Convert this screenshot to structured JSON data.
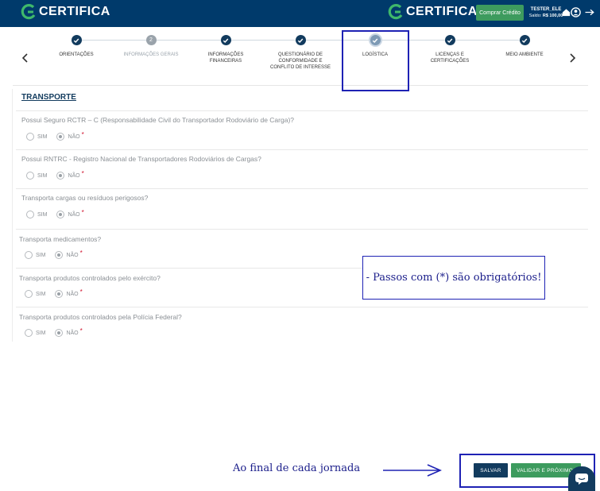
{
  "header": {
    "brand": "CERTIFICA",
    "buy_credit_label": "Comprar Crédito",
    "user_name": "TESTER_ELE",
    "balance_label": "Saldo:",
    "balance_value": "R$ 100,00"
  },
  "stepper": {
    "steps": [
      {
        "label": "ORIENTAÇÕES",
        "state": "done"
      },
      {
        "label": "INFORMAÇÕES GERAIS",
        "state": "number",
        "number": "2"
      },
      {
        "label": "INFORMAÇÕES FINANCEIRAS",
        "state": "done"
      },
      {
        "label": "QUESTIONÁRIO DE CONFORMIDADE E CONFLITO DE INTERESSE",
        "state": "done"
      },
      {
        "label": "LOGÍSTICA",
        "state": "active"
      },
      {
        "label": "LICENÇAS E CERTIFICAÇÕES",
        "state": "done"
      },
      {
        "label": "MEIO AMBIENTE",
        "state": "done"
      }
    ]
  },
  "section": {
    "title": "TRANSPORTE",
    "yes_label": "SIM",
    "no_label": "NÃO",
    "required_mark": "*",
    "questions": [
      {
        "text": "Possui Seguro RCTR – C (Responsabilidade Civil do Transportador Rodoviário de Carga)?",
        "selected": "no"
      },
      {
        "text": "Possui RNTRC - Registro Nacional de Transportadores Rodoviários de Cargas?",
        "selected": "no"
      },
      {
        "text": "Transporta cargas ou resíduos perigosos?",
        "selected": "no"
      },
      {
        "text": "Transporta medicamentos?",
        "selected": "no"
      },
      {
        "text": "Transporta produtos controlados pelo exército?",
        "selected": "no"
      },
      {
        "text": "Transporta produtos controlados pela Polícia Federal?",
        "selected": "no"
      }
    ]
  },
  "annotations": {
    "required_note": "- Passos com (*) são obrigatórios!",
    "end_note": "Ao final de cada jornada"
  },
  "actions": {
    "save_label": "SALVAR",
    "validate_label": "VALIDAR E PRÓXIMO"
  },
  "colors": {
    "header": "#003a6b",
    "primary": "#123b5e",
    "success": "#3d9b5e",
    "annotation": "#1e22b4",
    "required": "#d0102a"
  }
}
